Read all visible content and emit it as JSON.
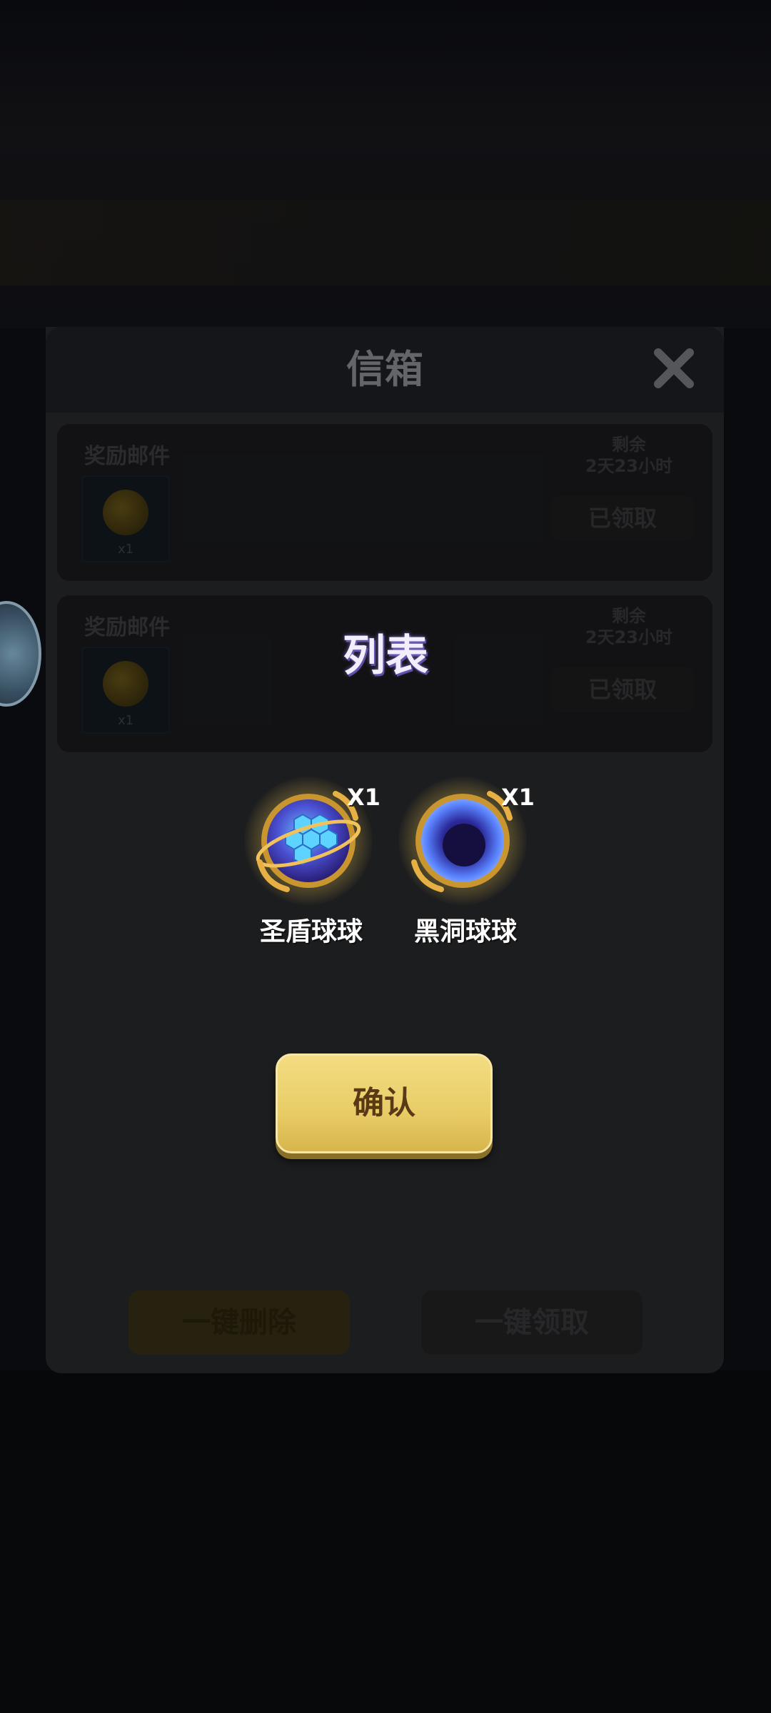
{
  "mailbox": {
    "title": "信箱",
    "mails": [
      {
        "title": "奖励邮件",
        "item_qty": "x1",
        "time_label": "剩余",
        "time_value": "2天23小时",
        "claim_label": "已领取"
      },
      {
        "title": "奖励邮件",
        "item_qty": "x1",
        "time_label": "剩余",
        "time_value": "2天23小时",
        "claim_label": "已领取"
      }
    ],
    "delete_all_label": "一键删除",
    "claim_all_label": "一键领取"
  },
  "popup": {
    "title": "列表",
    "rewards": [
      {
        "name": "圣盾球球",
        "qty": "X1",
        "icon": "shield-ball-icon"
      },
      {
        "name": "黑洞球球",
        "qty": "X1",
        "icon": "black-hole-ball-icon"
      }
    ],
    "confirm_label": "确认"
  },
  "colors": {
    "confirm_button": "#e8cc66",
    "popup_title_glow": "#7a66c8",
    "panel_bg": "#1e1f21"
  }
}
